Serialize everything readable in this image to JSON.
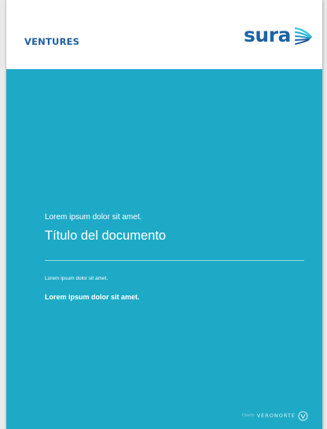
{
  "header": {
    "brand_tag": "VENTURES",
    "logo_text": "sura"
  },
  "cover": {
    "pre_title": "Lorem ipsum dolor sit amet.",
    "title": "Título del documento",
    "sub_small": "Lorem ipsum dolor sit amet.",
    "sub_bold": "Lorem ipsum dolor sit amet.",
    "footer_faint": "Diseño",
    "footer_brand": "VERONORTE"
  },
  "colors": {
    "cover_background": "#1eaac6",
    "brand_blue": "#1e63a4",
    "brand_tag_blue": "#1f5f9e",
    "wing_light": "#3ec6e0"
  },
  "icons": {
    "logo_wing": "wing-stripes-icon",
    "footer_badge": "circle-v-icon"
  }
}
